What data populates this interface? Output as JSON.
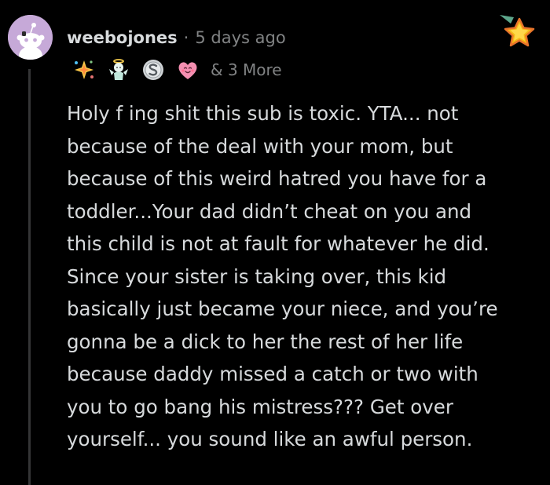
{
  "comment": {
    "username": "weebojones",
    "separator": "·",
    "timestamp": "5 days ago",
    "more_awards": "& 3 More",
    "awards": [
      {
        "icon": "sparkle-burst-award-icon"
      },
      {
        "icon": "angel-award-icon"
      },
      {
        "icon": "silver-s-award-icon"
      },
      {
        "icon": "heart-face-award-icon"
      }
    ],
    "body_lines": [
      "Holy f ing shit this sub is toxic. YTA... not",
      "because of the deal with your mom, but",
      "because of this weird hatred you have for a",
      "toddler...Your dad didn’t cheat on you and",
      "this child is not at fault for whatever he did.",
      "Since your sister is taking over, this kid",
      "basically just became your niece, and you’re",
      "gonna be a dick to her the rest of her life",
      "because daddy missed a catch or two with",
      "you to go bang his mistress??? Get over",
      "yourself... you sound like an awful person."
    ]
  },
  "colors": {
    "background": "#000000",
    "text": "#d7dadc",
    "meta": "#818384",
    "avatar_bg": "#c6a9d8",
    "thread_line": "#343536"
  }
}
